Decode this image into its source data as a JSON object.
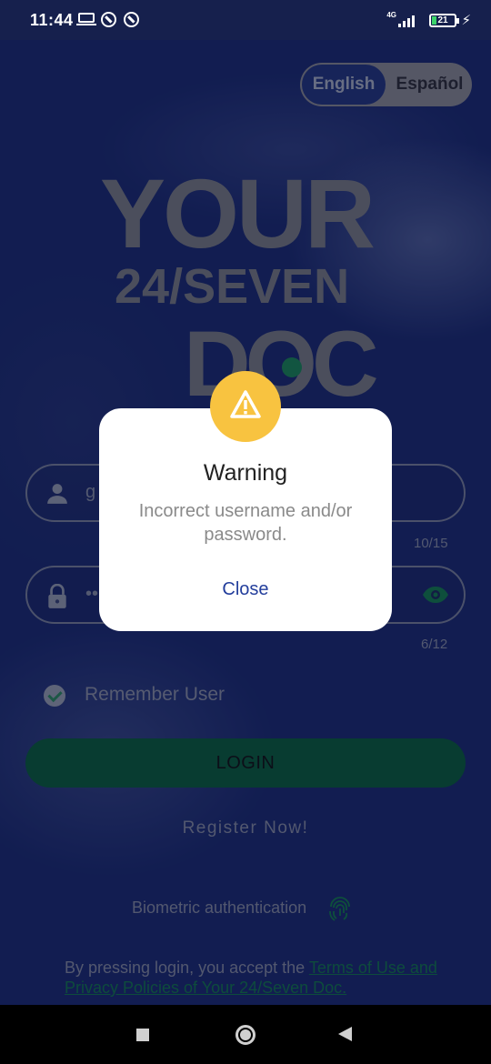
{
  "status_bar": {
    "time": "11:44",
    "network": "4G",
    "battery": "21"
  },
  "language": {
    "english": "English",
    "spanish": "Español",
    "selected": "English"
  },
  "logo": {
    "line1": "YOUR",
    "line2": "24/SEVEN",
    "line3": "DOC"
  },
  "form": {
    "username_value": "g",
    "username_counter": "10/15",
    "password_value": "••",
    "password_counter": "6/12",
    "remember_label": "Remember User",
    "remember_checked": true,
    "login_label": "LOGIN",
    "register_label": "Register Now!",
    "biometric_label": "Biometric authentication",
    "terms_prefix": "By pressing login, you accept the ",
    "terms_link": "Terms of Use and Privacy Policies of Your 24/Seven Doc."
  },
  "dialog": {
    "title": "Warning",
    "message": "Incorrect username and/or password.",
    "close_label": "Close"
  },
  "colors": {
    "background": "#1a2a72",
    "accent_green": "#0a5f3b",
    "warning_yellow": "#f8c340",
    "dialog_link": "#233e9c"
  },
  "icons": {
    "user": "user-icon",
    "lock": "lock-icon",
    "eye": "eye-icon",
    "check": "check-circle-icon",
    "fingerprint": "fingerprint-icon",
    "warning": "warning-triangle-icon"
  }
}
